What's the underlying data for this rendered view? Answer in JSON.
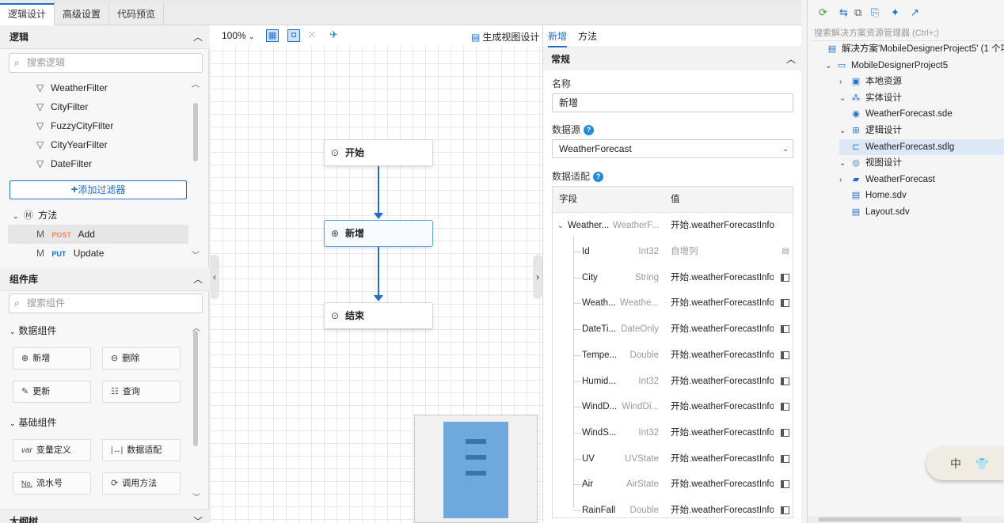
{
  "tabs": [
    {
      "label": "逻辑设计",
      "active": true
    },
    {
      "label": "高级设置",
      "active": false
    },
    {
      "label": "代码预览",
      "active": false
    }
  ],
  "logic": {
    "title": "逻辑",
    "search_placeholder": "搜索逻辑",
    "filters": [
      "WeatherFilter",
      "CityFilter",
      "FuzzyCityFilter",
      "CityYearFilter",
      "DateFilter"
    ],
    "add_filter_label": "添加过滤器",
    "methods_label": "方法",
    "methods": [
      {
        "verb": "POST",
        "name": "Add",
        "verb_color": "#f08a5d"
      },
      {
        "verb": "PUT",
        "name": "Update",
        "verb_color": "#1f6fd0"
      }
    ]
  },
  "components": {
    "title": "组件库",
    "search_placeholder": "搜索组件",
    "data_group": "数据组件",
    "data_items": [
      "新增",
      "删除",
      "更新",
      "查询"
    ],
    "basic_group": "基础组件",
    "basic_items": [
      "变量定义",
      "数据适配",
      "流水号",
      "调用方法"
    ],
    "basic_icons": [
      "var",
      "|↔|",
      "No.",
      "⟳"
    ]
  },
  "outline": {
    "title": "大纲树"
  },
  "canvas": {
    "zoom": "100%",
    "generate_view_label": "生成视图设计",
    "nodes": [
      "开始",
      "新增",
      "结束"
    ]
  },
  "props": {
    "tabs": [
      "新增",
      "方法"
    ],
    "group": "常规",
    "name_label": "名称",
    "name_value": "新增",
    "source_label": "数据源",
    "source_value": "WeatherForecast",
    "mapping_label": "数据适配",
    "grid_header_field": "字段",
    "grid_header_value": "值",
    "parent": {
      "field": "Weather...",
      "type": "WeatherF...",
      "value": "开始.weatherForecastInfo"
    },
    "rows": [
      {
        "field": "Id",
        "type": "Int32",
        "value": "自增列"
      },
      {
        "field": "City",
        "type": "String",
        "value": "开始.weatherForecastInfo.C"
      },
      {
        "field": "Weath...",
        "type": "Weathe...",
        "value": "开始.weatherForecastInfo.V"
      },
      {
        "field": "DateTi...",
        "type": "DateOnly",
        "value": "开始.weatherForecastInfo.D"
      },
      {
        "field": "Tempe...",
        "type": "Double",
        "value": "开始.weatherForecastInfo.T"
      },
      {
        "field": "Humid...",
        "type": "Int32",
        "value": "开始.weatherForecastInfo.H"
      },
      {
        "field": "WindD...",
        "type": "WindDi...",
        "value": "开始.weatherForecastInfo.V"
      },
      {
        "field": "WindS...",
        "type": "Int32",
        "value": "开始.weatherForecastInfo.V"
      },
      {
        "field": "UV",
        "type": "UVState",
        "value": "开始.weatherForecastInfo.U"
      },
      {
        "field": "Air",
        "type": "AirState",
        "value": "开始.weatherForecastInfo.A"
      },
      {
        "field": "RainFall",
        "type": "Double",
        "value": "开始.weatherForecastInfo.R"
      }
    ]
  },
  "solution": {
    "search_placeholder": "搜索解决方案资源管理器 (Ctrl+;)",
    "items": [
      {
        "label": "解决方案'MobileDesignerProject5' (1 个项",
        "depth": 0,
        "arrow": "",
        "icon": "▤"
      },
      {
        "label": "MobileDesignerProject5",
        "depth": 1,
        "arrow": "⌄",
        "icon": "▭"
      },
      {
        "label": "本地资源",
        "depth": 2,
        "arrow": "›",
        "icon": "▣"
      },
      {
        "label": "实体设计",
        "depth": 2,
        "arrow": "⌄",
        "icon": "⁂"
      },
      {
        "label": "WeatherForecast.sde",
        "depth": 3,
        "arrow": "",
        "icon": "◉"
      },
      {
        "label": "逻辑设计",
        "depth": 2,
        "arrow": "⌄",
        "icon": "⊞"
      },
      {
        "label": "WeatherForecast.sdlg",
        "depth": 3,
        "arrow": "",
        "icon": "⊏"
      },
      {
        "label": "视图设计",
        "depth": 2,
        "arrow": "⌄",
        "icon": "◎"
      },
      {
        "label": "WeatherForecast",
        "depth": 3,
        "arrow": "›",
        "icon": "▰"
      },
      {
        "label": "Home.sdv",
        "depth": 3,
        "arrow": "",
        "icon": "▤"
      },
      {
        "label": "Layout.sdv",
        "depth": 3,
        "arrow": "",
        "icon": "▤"
      }
    ]
  },
  "widget": {
    "label": "中"
  }
}
